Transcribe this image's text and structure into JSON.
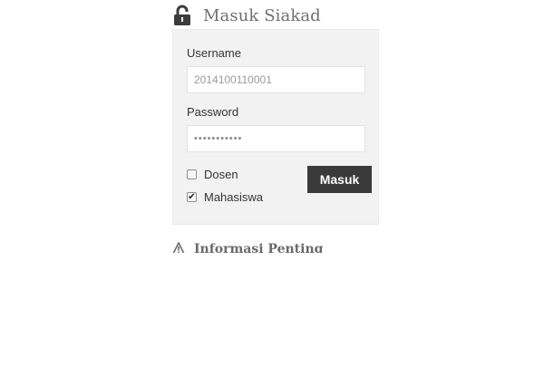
{
  "header": {
    "icon": "lock-open-icon",
    "title": "Masuk Siakad"
  },
  "form": {
    "username_label": "Username",
    "username_placeholder": "2014100110001",
    "password_label": "Password",
    "password_masked": "•••••••••••",
    "roles": [
      {
        "label": "Dosen",
        "checked": false
      },
      {
        "label": "Mahasiswa",
        "checked": true
      }
    ],
    "submit_label": "Masuk"
  },
  "info": {
    "icon": "warning-icon",
    "title": "Informasi Penting"
  },
  "colors": {
    "panel_bg": "#f2f2f2",
    "button_bg": "#3a3a3a",
    "title_text": "#6f6f6f"
  }
}
